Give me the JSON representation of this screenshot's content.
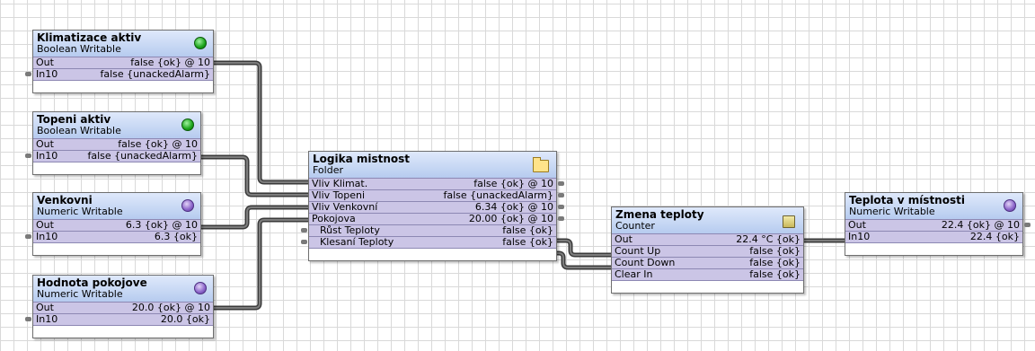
{
  "nodes": {
    "klimatizace": {
      "title": "Klimatizace aktiv",
      "type": "Boolean Writable",
      "icon": "green-status-icon",
      "slots": [
        {
          "label": "Out",
          "value": "false {ok} @ 10"
        },
        {
          "label": "In10",
          "value": "false {unackedAlarm}"
        }
      ]
    },
    "topeni": {
      "title": "Topeni aktiv",
      "type": "Boolean Writable",
      "icon": "green-status-icon",
      "slots": [
        {
          "label": "Out",
          "value": "false {ok} @ 10"
        },
        {
          "label": "In10",
          "value": "false {unackedAlarm}"
        }
      ]
    },
    "venkovni": {
      "title": "Venkovni",
      "type": "Numeric Writable",
      "icon": "purple-status-icon",
      "slots": [
        {
          "label": "Out",
          "value": "6.3 {ok} @ 10"
        },
        {
          "label": "In10",
          "value": "6.3 {ok}"
        }
      ]
    },
    "pokojove": {
      "title": "Hodnota pokojove",
      "type": "Numeric Writable",
      "icon": "purple-status-icon",
      "slots": [
        {
          "label": "Out",
          "value": "20.0 {ok} @ 10"
        },
        {
          "label": "In10",
          "value": "20.0 {ok}"
        }
      ]
    },
    "logika": {
      "title": "Logika mistnost",
      "type": "Folder",
      "icon": "folder-icon",
      "slots": [
        {
          "label": "Vliv Klimat.",
          "value": "false {ok} @ 10"
        },
        {
          "label": "Vliv Topeni",
          "value": "false {unackedAlarm}"
        },
        {
          "label": "Vliv Venkovní",
          "value": "6.34 {ok} @ 10"
        },
        {
          "label": "Pokojova",
          "value": "20.00 {ok} @ 10"
        },
        {
          "label": "Růst Teploty",
          "value": "false {ok}"
        },
        {
          "label": "Klesaní Teploty",
          "value": "false {ok}"
        }
      ]
    },
    "zmena": {
      "title": "Zmena teploty",
      "type": "Counter",
      "icon": "counter-icon",
      "slots": [
        {
          "label": "Out",
          "value": "22.4 °C {ok}"
        },
        {
          "label": "Count Up",
          "value": "false {ok}"
        },
        {
          "label": "Count Down",
          "value": "false {ok}"
        },
        {
          "label": "Clear In",
          "value": "false {ok}"
        }
      ]
    },
    "teplota": {
      "title": "Teplota v místnosti",
      "type": "Numeric Writable",
      "icon": "purple-status-icon",
      "slots": [
        {
          "label": "Out",
          "value": "22.4 {ok} @ 10"
        },
        {
          "label": "In10",
          "value": "22.4 {ok}"
        }
      ]
    }
  },
  "colors": {
    "header_top": "#dfe9fb",
    "header_bottom": "#b6cbef",
    "slot_fill": "#cbc5e6",
    "wire_outer": "#3a3a3a",
    "wire_inner": "#7d7d7d"
  }
}
